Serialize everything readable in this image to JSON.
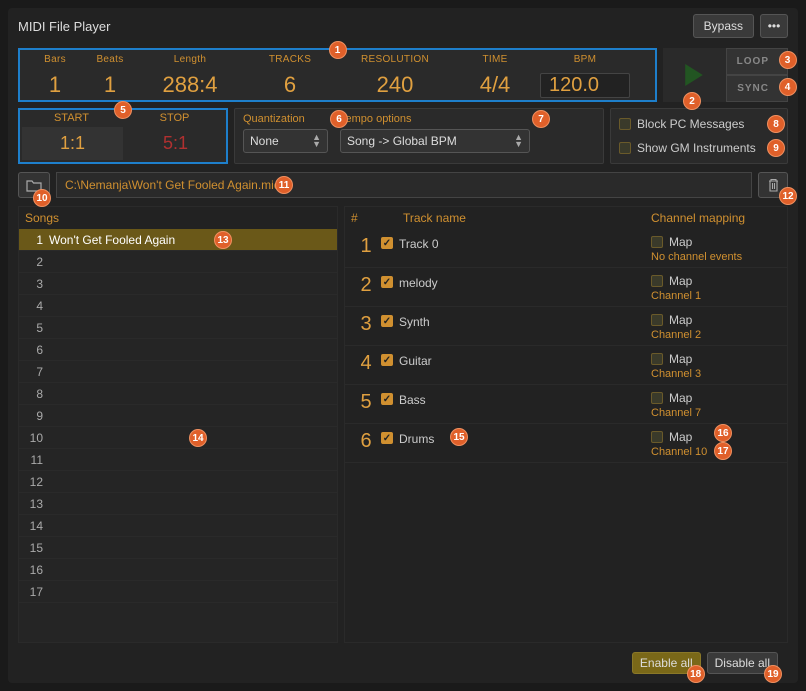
{
  "title": "MIDI File Player",
  "titlebar": {
    "bypass": "Bypass",
    "menu": "•••"
  },
  "info": {
    "bars": {
      "label": "Bars",
      "value": "1"
    },
    "beats": {
      "label": "Beats",
      "value": "1"
    },
    "length": {
      "label": "Length",
      "value": "288:4"
    },
    "tracks": {
      "label": "TRACKS",
      "value": "6"
    },
    "resolution": {
      "label": "RESOLUTION",
      "value": "240"
    },
    "time": {
      "label": "TIME",
      "value": "4/4"
    },
    "bpm": {
      "label": "BPM",
      "value": "120.0"
    }
  },
  "play": {
    "loop": "LOOP",
    "sync": "SYNC"
  },
  "startstop": {
    "start_label": "START",
    "start_value": "1:1",
    "stop_label": "STOP",
    "stop_value": "5:1"
  },
  "quantization": {
    "label": "Quantization",
    "value": "None"
  },
  "tempo": {
    "label": "Tempo options",
    "value": "Song -> Global BPM"
  },
  "options": {
    "block_pc": "Block PC Messages",
    "show_gm": "Show GM Instruments"
  },
  "filepath": "C:\\Nemanja\\Won't Get Fooled Again.mid",
  "songs": {
    "header": "Songs"
  },
  "tracklist": {
    "headers": {
      "num": "#",
      "name": "Track name",
      "map": "Channel mapping"
    }
  },
  "songrows": [
    {
      "name": "Won't Get Fooled Again",
      "selected": true
    },
    {
      "name": ""
    },
    {
      "name": ""
    },
    {
      "name": ""
    },
    {
      "name": ""
    },
    {
      "name": ""
    },
    {
      "name": ""
    },
    {
      "name": ""
    },
    {
      "name": ""
    },
    {
      "name": ""
    },
    {
      "name": ""
    },
    {
      "name": ""
    },
    {
      "name": ""
    },
    {
      "name": ""
    },
    {
      "name": ""
    },
    {
      "name": ""
    },
    {
      "name": ""
    }
  ],
  "tracks": [
    {
      "name": "Track 0",
      "enabled": true,
      "map": "Map",
      "channel": "No channel events"
    },
    {
      "name": "melody",
      "enabled": true,
      "map": "Map",
      "channel": "Channel 1"
    },
    {
      "name": "Synth",
      "enabled": true,
      "map": "Map",
      "channel": "Channel 2"
    },
    {
      "name": "Guitar",
      "enabled": true,
      "map": "Map",
      "channel": "Channel 3"
    },
    {
      "name": "Bass",
      "enabled": true,
      "map": "Map",
      "channel": "Channel 7"
    },
    {
      "name": "Drums",
      "enabled": true,
      "map": "Map",
      "channel": "Channel 10"
    }
  ],
  "footer": {
    "enable": "Enable all",
    "disable": "Disable all"
  },
  "markers": [
    "1",
    "2",
    "3",
    "4",
    "5",
    "6",
    "7",
    "8",
    "9",
    "10",
    "11",
    "12",
    "13",
    "14",
    "15",
    "16",
    "17",
    "18",
    "19"
  ]
}
